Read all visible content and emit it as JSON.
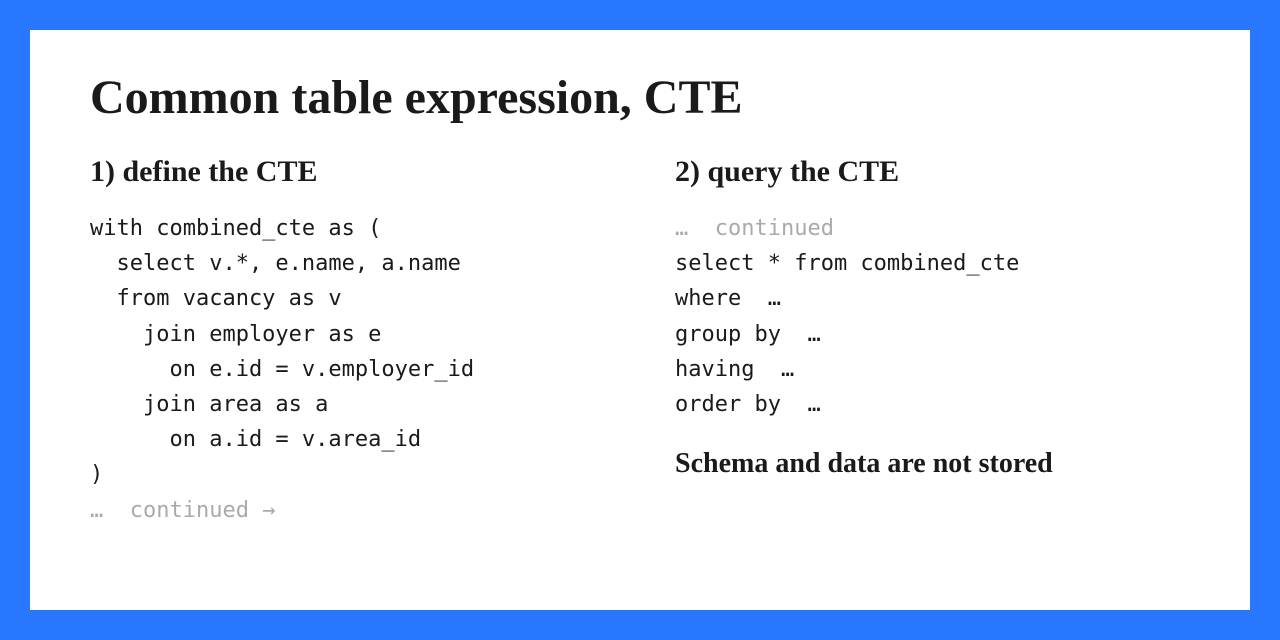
{
  "title": "Common table expression, CTE",
  "left": {
    "heading": "1) define the CTE",
    "code_lines": [
      "with combined_cte as (",
      "  select v.*, e.name, a.name",
      "  from vacancy as v",
      "    join employer as e",
      "      on e.id = v.employer_id",
      "    join area as a",
      "      on a.id = v.area_id",
      ")"
    ],
    "continued_prefix": "…  ",
    "continued_text": "continued →"
  },
  "right": {
    "heading": "2) query the CTE",
    "continued_prefix": "…  ",
    "continued_text": "continued",
    "code_lines": [
      "select * from combined_cte",
      "where  …",
      "group by  …",
      "having  …",
      "order by  …"
    ],
    "note": "Schema and data are not stored"
  }
}
